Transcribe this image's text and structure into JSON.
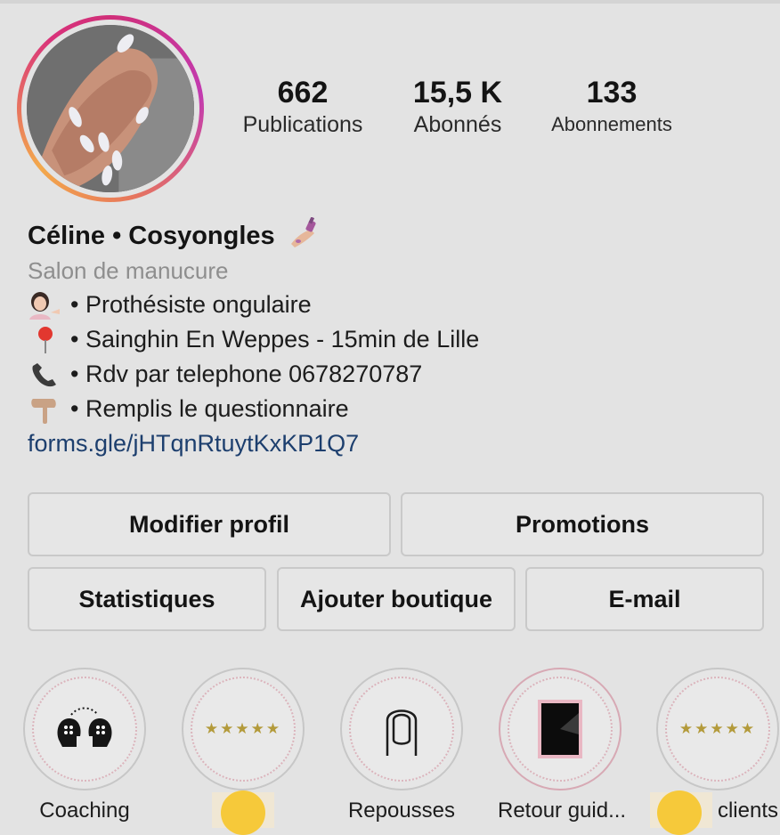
{
  "stats": {
    "publications": {
      "value": "662",
      "label": "Publications"
    },
    "followers": {
      "value": "15,5 K",
      "label": "Abonnés"
    },
    "following": {
      "value": "133",
      "label": "Abonnements"
    }
  },
  "profile": {
    "name": "Céline • Cosyongles",
    "category": "Salon de manucure",
    "bio_lines": [
      {
        "icon": "woman-tipping-hand-emoji",
        "text": "• Prothésiste ongulaire"
      },
      {
        "icon": "round-pushpin-emoji",
        "text": "• Sainghin En Weppes - 15min de Lille"
      },
      {
        "icon": "telephone-receiver-emoji",
        "text": "• Rdv par telephone 0678270787"
      },
      {
        "icon": "pointing-down-emoji",
        "text": "• Remplis le questionnaire"
      }
    ],
    "link": "forms.gle/jHTqnRtuytKxKP1Q7"
  },
  "buttons": {
    "edit_profile": "Modifier profil",
    "promotions": "Promotions",
    "insights": "Statistiques",
    "add_shop": "Ajouter boutique",
    "email": "E-mail"
  },
  "highlights": [
    {
      "label": "Coaching",
      "icon": "coaching-heads-icon"
    },
    {
      "label": "",
      "icon": "five-stars-icon"
    },
    {
      "label": "Repousses",
      "icon": "fingernail-icon"
    },
    {
      "label": "Retour guid...",
      "icon": "tablet-icon"
    },
    {
      "label": "clients",
      "icon": "five-stars-icon"
    }
  ],
  "stars_text": "★★★★★",
  "colors": {
    "link": "#1d3f6e",
    "category": "#8e8e8e",
    "ring_start": "#d02f79",
    "ring_end": "#f3a94b",
    "overlay_dot": "#f6c93a"
  }
}
